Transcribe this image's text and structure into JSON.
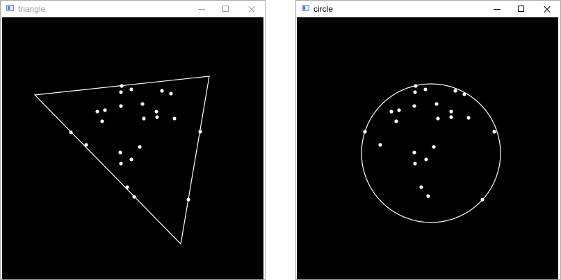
{
  "windows": [
    {
      "title": "triangle",
      "active": false
    },
    {
      "title": "circle",
      "active": true
    }
  ],
  "icons": {
    "app": "opencv-window-icon",
    "minimize": "minimize-icon",
    "maximize": "maximize-icon",
    "close": "close-icon"
  },
  "colors": {
    "canvas": "#000000",
    "drawing": "#ffffff",
    "inactive_title": "#9a9a9a",
    "active_title": "#000000"
  }
}
